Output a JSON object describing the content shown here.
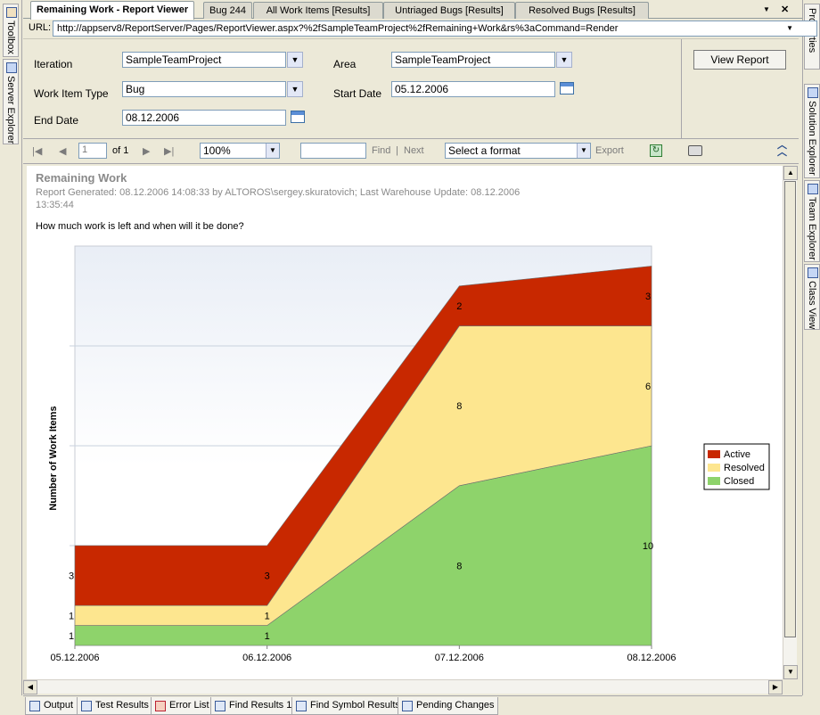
{
  "tabs": {
    "items": [
      {
        "label": "Remaining Work - Report Viewer",
        "active": true
      },
      {
        "label": "Bug 244"
      },
      {
        "label": "All Work Items [Results]"
      },
      {
        "label": "Untriaged Bugs [Results]"
      },
      {
        "label": "Resolved Bugs [Results]"
      }
    ],
    "dropdown_glyph": "▼",
    "close_glyph": "✕"
  },
  "url": {
    "label": "URL:",
    "value": "http://appserv8/ReportServer/Pages/ReportViewer.aspx?%2fSampleTeamProject%2fRemaining+Work&rs%3aCommand=Render"
  },
  "side_left": {
    "toolbox": "Toolbox",
    "server_explorer": "Server Explorer"
  },
  "side_right": {
    "properties": "Properties",
    "solution_explorer": "Solution Explorer",
    "team_explorer": "Team Explorer",
    "class_view": "Class View"
  },
  "params": {
    "iteration_label": "Iteration",
    "iteration_value": "SampleTeamProject",
    "area_label": "Area",
    "area_value": "SampleTeamProject",
    "work_item_type_label": "Work Item Type",
    "work_item_type_value": "Bug",
    "start_date_label": "Start Date",
    "start_date_value": "05.12.2006",
    "end_date_label": "End Date",
    "end_date_value": "08.12.2006",
    "view_report": "View Report"
  },
  "toolbar": {
    "page_value": "1",
    "page_of": "of 1",
    "zoom_value": "100%",
    "find_label": "Find",
    "separator": "|",
    "next_label": "Next",
    "format_value": "Select a format",
    "export_label": "Export"
  },
  "report": {
    "title": "Remaining Work",
    "subtitle": "Report Generated: 08.12.2006 14:08:33 by ALTOROS\\sergey.skuratovich; Last Warehouse Update: 08.12.2006 13:35:44",
    "question": "How much work is left and when will it be done?"
  },
  "chart_data": {
    "type": "area",
    "stacked": true,
    "x": [
      "05.12.2006",
      "06.12.2006",
      "07.12.2006",
      "08.12.2006"
    ],
    "ylabel": "Number of Work Items",
    "ylim": [
      0,
      20
    ],
    "grid": true,
    "legend_position": "right",
    "series": [
      {
        "name": "Closed",
        "values": [
          1,
          1,
          8,
          10
        ],
        "color": "#8ed36b"
      },
      {
        "name": "Resolved",
        "values": [
          1,
          1,
          8,
          6
        ],
        "color": "#fde68f"
      },
      {
        "name": "Active",
        "values": [
          3,
          3,
          2,
          3
        ],
        "color": "#c82800"
      }
    ]
  },
  "bottom_tabs": [
    {
      "label": "Output",
      "icon": "output-icon"
    },
    {
      "label": "Test Results",
      "icon": "test-results-icon"
    },
    {
      "label": "Error List",
      "icon": "error-list-icon"
    },
    {
      "label": "Find Results 1",
      "icon": "find-results-icon"
    },
    {
      "label": "Find Symbol Results",
      "icon": "find-symbol-icon"
    },
    {
      "label": "Pending Changes",
      "icon": "pending-changes-icon"
    }
  ]
}
